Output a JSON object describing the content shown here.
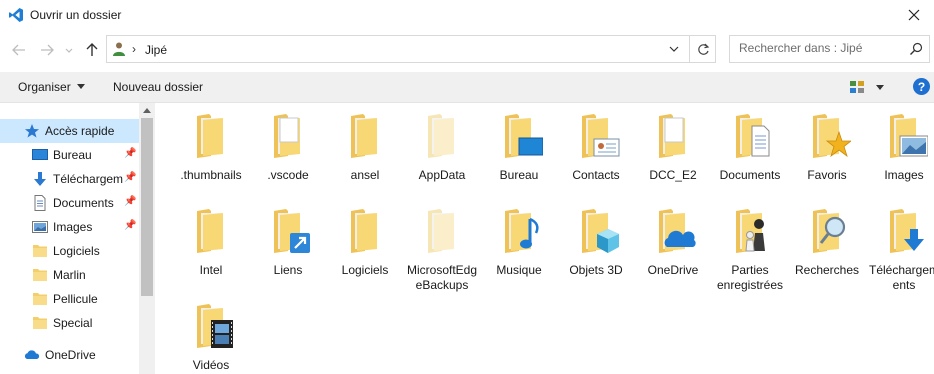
{
  "window": {
    "title": "Ouvrir un dossier",
    "close_icon": "close-icon",
    "app_icon": "vscode-icon"
  },
  "navigation": {
    "back_icon": "arrow-left-icon",
    "forward_icon": "arrow-right-icon",
    "recent_icon": "chevron-down-icon",
    "up_icon": "arrow-up-icon"
  },
  "address": {
    "location_icon": "user-folder-icon",
    "separator": "›",
    "crumb": "Jipé"
  },
  "search": {
    "placeholder": "Rechercher dans : Jipé"
  },
  "toolbar": {
    "organize_label": "Organiser",
    "new_folder_label": "Nouveau dossier",
    "help_label": "?"
  },
  "sidebar": {
    "items": [
      {
        "label": "Accès rapide",
        "icon": "star-icon",
        "selected": true
      },
      {
        "label": "Bureau",
        "icon": "desktop-icon",
        "pinned": true
      },
      {
        "label": "Téléchargements",
        "icon": "download-icon",
        "pinned": true
      },
      {
        "label": "Documents",
        "icon": "documents-icon",
        "pinned": true
      },
      {
        "label": "Images",
        "icon": "pictures-icon",
        "pinned": true
      },
      {
        "label": "Logiciels",
        "icon": "folder-icon"
      },
      {
        "label": "Marlin",
        "icon": "folder-icon"
      },
      {
        "label": "Pellicule",
        "icon": "folder-icon"
      },
      {
        "label": "Special",
        "icon": "folder-icon"
      },
      {
        "label": "OneDrive",
        "icon": "cloud-icon"
      }
    ]
  },
  "folders": [
    {
      "name": ".thumbnails",
      "overlay": "none"
    },
    {
      "name": ".vscode",
      "overlay": "blank"
    },
    {
      "name": "ansel",
      "overlay": "none"
    },
    {
      "name": "AppData",
      "overlay": "none",
      "hidden": true
    },
    {
      "name": "Bureau",
      "overlay": "desktop"
    },
    {
      "name": "Contacts",
      "overlay": "contact"
    },
    {
      "name": "DCC_E2",
      "overlay": "blank"
    },
    {
      "name": "Documents",
      "overlay": "document"
    },
    {
      "name": "Favoris",
      "overlay": "star"
    },
    {
      "name": "Images",
      "overlay": "picture"
    },
    {
      "name": "Intel",
      "overlay": "none"
    },
    {
      "name": "Liens",
      "overlay": "link"
    },
    {
      "name": "Logiciels",
      "overlay": "none"
    },
    {
      "name": "MicrosoftEdgeBackups",
      "overlay": "none",
      "hidden": true
    },
    {
      "name": "Musique",
      "overlay": "music"
    },
    {
      "name": "Objets 3D",
      "overlay": "cube"
    },
    {
      "name": "OneDrive",
      "overlay": "cloud"
    },
    {
      "name": "Parties enregistrées",
      "overlay": "chess"
    },
    {
      "name": "Recherches",
      "overlay": "magnifier"
    },
    {
      "name": "Téléchargements",
      "overlay": "download"
    },
    {
      "name": "Vidéos",
      "overlay": "film"
    }
  ]
}
